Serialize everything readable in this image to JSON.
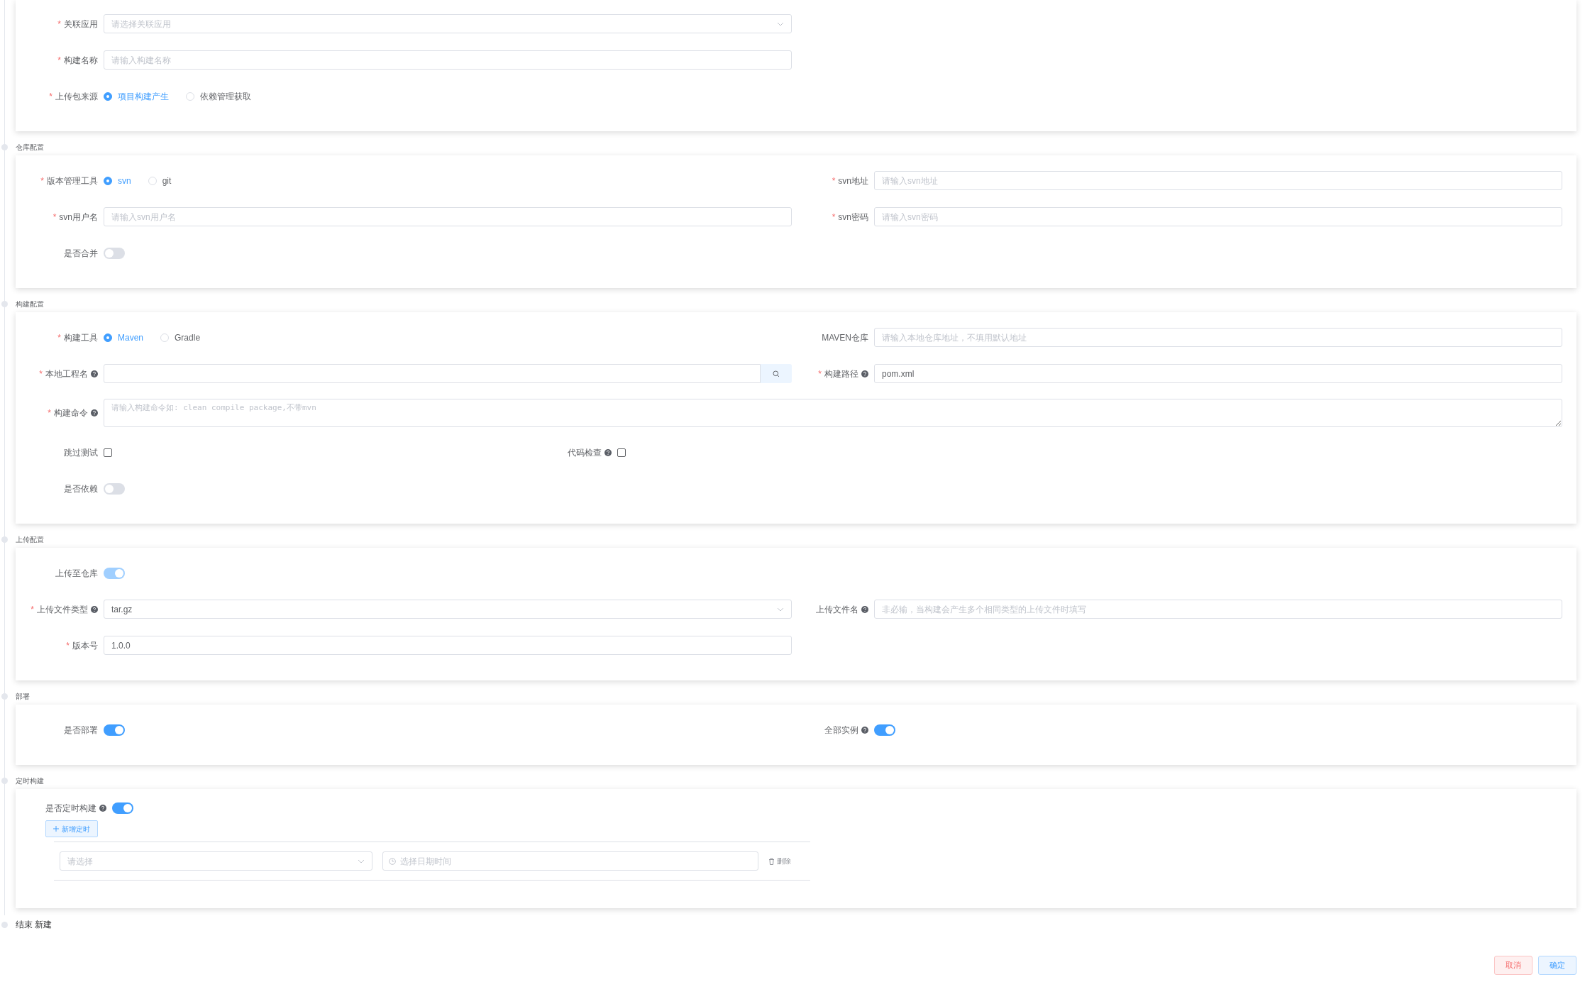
{
  "sections": [
    {
      "rows": [
        [
          {
            "kind": "select",
            "label": "关联应用",
            "mark": "*",
            "placeholder": "请选择关联应用"
          }
        ],
        [
          {
            "kind": "input",
            "label": "构建名称",
            "mark": "*",
            "placeholder": "请输入构建名称"
          }
        ],
        [
          {
            "kind": "radio",
            "label": "上传包来源",
            "mark": "*",
            "options": [
              {
                "label": "项目构建产生",
                "selected": true
              },
              {
                "label": "依赖管理获取",
                "selected": false
              }
            ]
          }
        ]
      ]
    },
    {
      "title": "仓库配置",
      "rows": [
        [
          {
            "kind": "radio",
            "label": "版本管理工具",
            "mark": "*",
            "options": [
              {
                "label": "svn",
                "selected": true
              },
              {
                "label": "git",
                "selected": false
              }
            ]
          },
          {
            "kind": "input",
            "label": "svn地址",
            "mark": "*",
            "placeholder": "请输入svn地址"
          }
        ],
        [
          {
            "kind": "input",
            "label": "svn用户名",
            "mark": "*",
            "placeholder": "请输入svn用户名"
          },
          {
            "kind": "input",
            "label": "svn密码",
            "mark": "*",
            "placeholder": "请输入svn密码"
          }
        ],
        [
          {
            "kind": "switch",
            "label": "是否合并",
            "on": false
          }
        ]
      ]
    },
    {
      "title": "构建配置",
      "rows": [
        [
          {
            "kind": "radio",
            "label": "构建工具",
            "mark": "*",
            "options": [
              {
                "label": "Maven",
                "selected": true
              },
              {
                "label": "Gradle",
                "selected": false
              }
            ]
          },
          {
            "kind": "input",
            "label": "MAVEN仓库",
            "placeholder": "请输入本地仓库地址，不填用默认地址"
          }
        ],
        [
          {
            "kind": "search",
            "label": "本地工程名",
            "mark": "*",
            "help": true
          },
          {
            "kind": "input",
            "label": "构建路径",
            "mark": "*",
            "help": true,
            "value": "pom.xml"
          }
        ],
        [
          {
            "kind": "textarea",
            "label": "构建命令",
            "mark": "*",
            "help": true,
            "placeholder": "请输入构建命令如: clean compile package,不带mvn"
          }
        ],
        [
          {
            "kind": "checkbox",
            "label": "跳过测试",
            "checked": false
          },
          {
            "kind": "checkbox",
            "label": "代码检查",
            "help": true,
            "checked": false
          }
        ],
        [
          {
            "kind": "switch",
            "label": "是否依赖",
            "on": false
          }
        ]
      ]
    },
    {
      "title": "上传配置",
      "rows": [
        [
          {
            "kind": "switch",
            "label": "上传至仓库",
            "on": true,
            "disabled": true
          }
        ],
        [
          {
            "kind": "select",
            "label": "上传文件类型",
            "mark": "*",
            "help": true,
            "value": "tar.gz"
          },
          {
            "kind": "input",
            "label": "上传文件名",
            "help": true,
            "placeholder": "非必输，当构建会产生多个相同类型的上传文件时填写"
          }
        ],
        [
          {
            "kind": "input",
            "label": "版本号",
            "mark": "*",
            "value": "1.0.0"
          }
        ]
      ]
    },
    {
      "title": "部署",
      "rows": [
        [
          {
            "kind": "switch",
            "label": "是否部署",
            "on": true
          },
          {
            "kind": "switch",
            "label": "全部实例",
            "help": true,
            "on": true
          }
        ]
      ]
    },
    {
      "title": "定时构建",
      "timer": {
        "label": "是否定时构建",
        "help": true,
        "on": true,
        "add_button": "新增定时",
        "schedules": [
          {
            "type_placeholder": "请选择",
            "time_placeholder": "选择日期时间",
            "delete_label": "删除"
          }
        ]
      }
    }
  ],
  "end_label": "结束 新建",
  "buttons": [
    {
      "label": "取消",
      "kind": "cancel"
    },
    {
      "label": "确定",
      "kind": "confirm"
    }
  ]
}
